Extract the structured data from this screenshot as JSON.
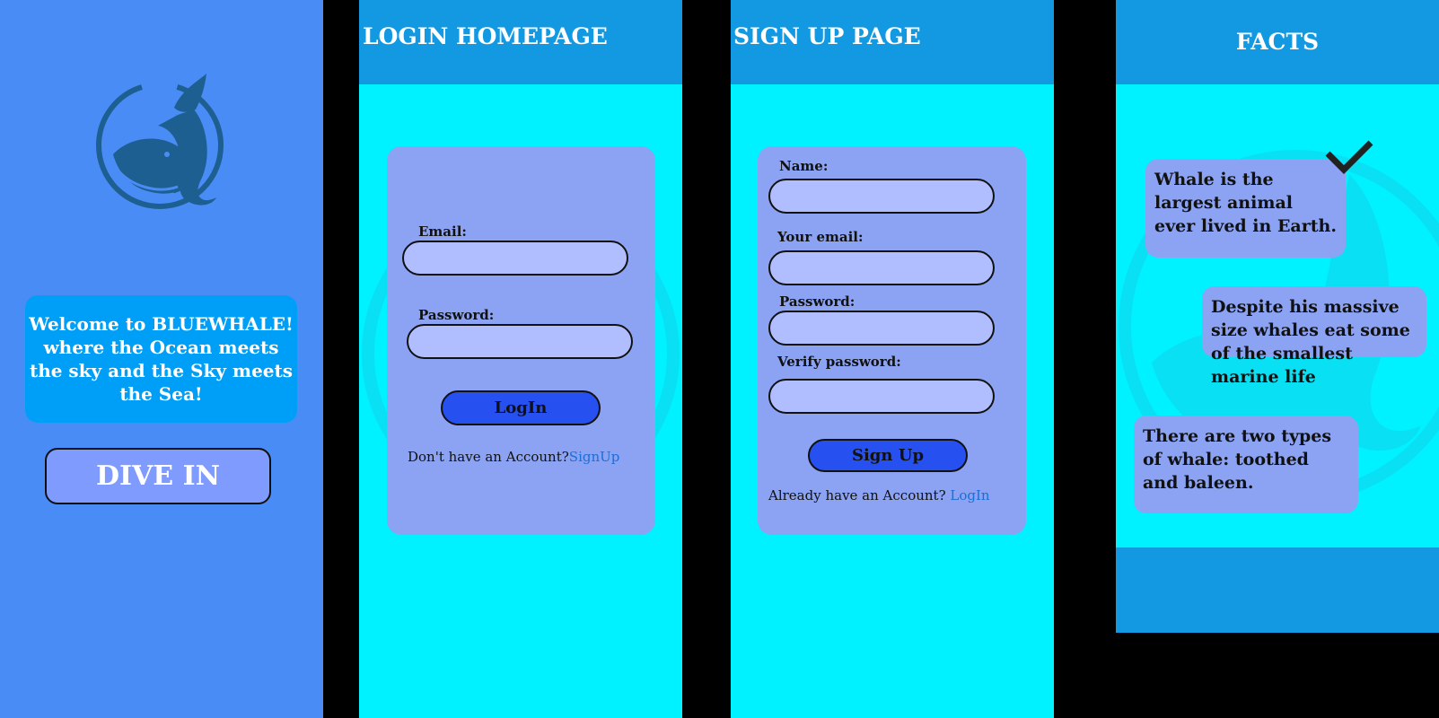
{
  "welcome": {
    "message": "Welcome to BLUEWHALE! where the Ocean meets the sky and the Sky meets the Sea!",
    "dive_button": "DIVE IN"
  },
  "login": {
    "title": "LOGIN HOMEPAGE",
    "email_label": "Email:",
    "password_label": "Password:",
    "login_button": "LogIn",
    "no_account_text": "Don't have an Account?",
    "signup_link": "SignUp"
  },
  "signup": {
    "title": "SIGN UP PAGE",
    "name_label": "Name:",
    "email_label": "Your email:",
    "password_label": "Password:",
    "verify_label": "Verify password:",
    "signup_button": "Sign Up",
    "have_account_text": "Already have an Account?",
    "login_link": "LogIn"
  },
  "facts": {
    "title": "FACTS",
    "items": [
      "Whale is the largest animal ever lived in Earth.",
      "Despite his massive size whales eat some of the smallest marine life",
      "There are two types of whale: toothed and baleen."
    ]
  },
  "colors": {
    "welcome_bg": "#4a8cf5",
    "header": "#1399e2",
    "body": "#00f1ff",
    "card": "#8ba3f2",
    "field": "#b0beff",
    "button": "#2650f0",
    "link": "#1a6fd8"
  },
  "icons": [
    "whale-logo-icon",
    "checkmark-icon"
  ]
}
